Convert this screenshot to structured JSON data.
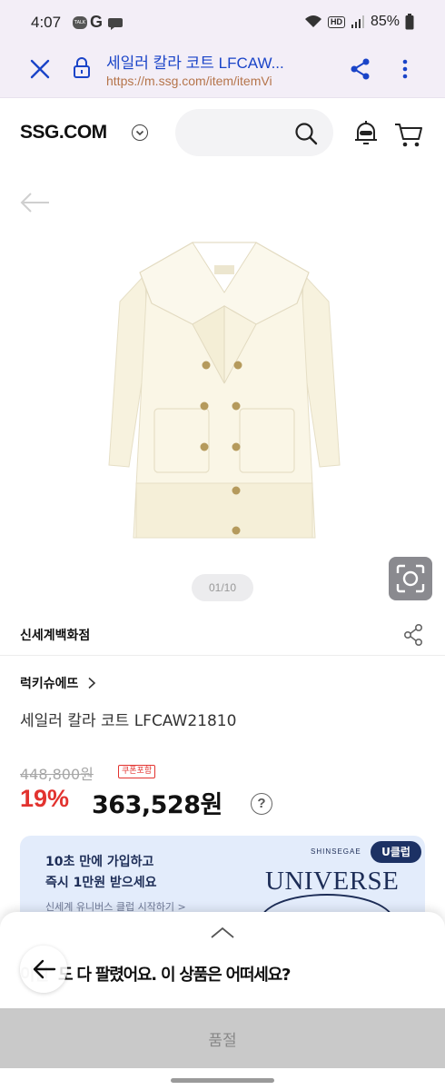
{
  "status_bar": {
    "time": "4:07",
    "talk_label": "TALK",
    "g_label": "G",
    "battery": "85%",
    "hd_label": "HD"
  },
  "browser": {
    "page_title": "세일러 칼라 코트 LFCAW...",
    "url": "https://m.ssg.com/item/itemVi",
    "close_icon": "close-icon",
    "lock_icon": "lock-icon",
    "share_icon": "share-icon",
    "more_icon": "more-vertical-icon"
  },
  "header": {
    "logo": "SSG.COM",
    "search_placeholder": "",
    "search_icon": "search-icon",
    "bell_icon": "bell-icon",
    "cart_icon": "cart-icon"
  },
  "gallery": {
    "page_indicator": "01/10",
    "back_icon": "arrow-left-icon",
    "lens_icon": "camera-lens-icon",
    "image_alt": "cream double-breasted sailor collar coat"
  },
  "product": {
    "store": "신세계백화점",
    "brand": "럭키슈에뜨",
    "title": "세일러 칼라 코트 LFCAW21810",
    "original_price": "448,800원",
    "coupon_badge": "쿠폰포함",
    "discount_rate": "19%",
    "sale_price": "363,528원",
    "help_mark": "?"
  },
  "banner": {
    "line1": "10초 만에 가입하고",
    "line2": "즉시 1만원 받으세요",
    "link": "신세계 유니버스 클럽 시작하기 >",
    "badge": "U클럽",
    "brand_small": "SHINSEGAE",
    "brand": "UNIVERSE"
  },
  "sheet": {
    "ghost_text": "이걸",
    "message": "도 다 팔렸어요. 이 상품은 어떠세요?",
    "soldout_label": "품절"
  },
  "colors": {
    "accent_red": "#e2332f",
    "browser_bg": "#f3eef7",
    "link_blue": "#1a44c8",
    "banner_bg": "#e3ecfb",
    "banner_navy": "#1d2d57"
  }
}
